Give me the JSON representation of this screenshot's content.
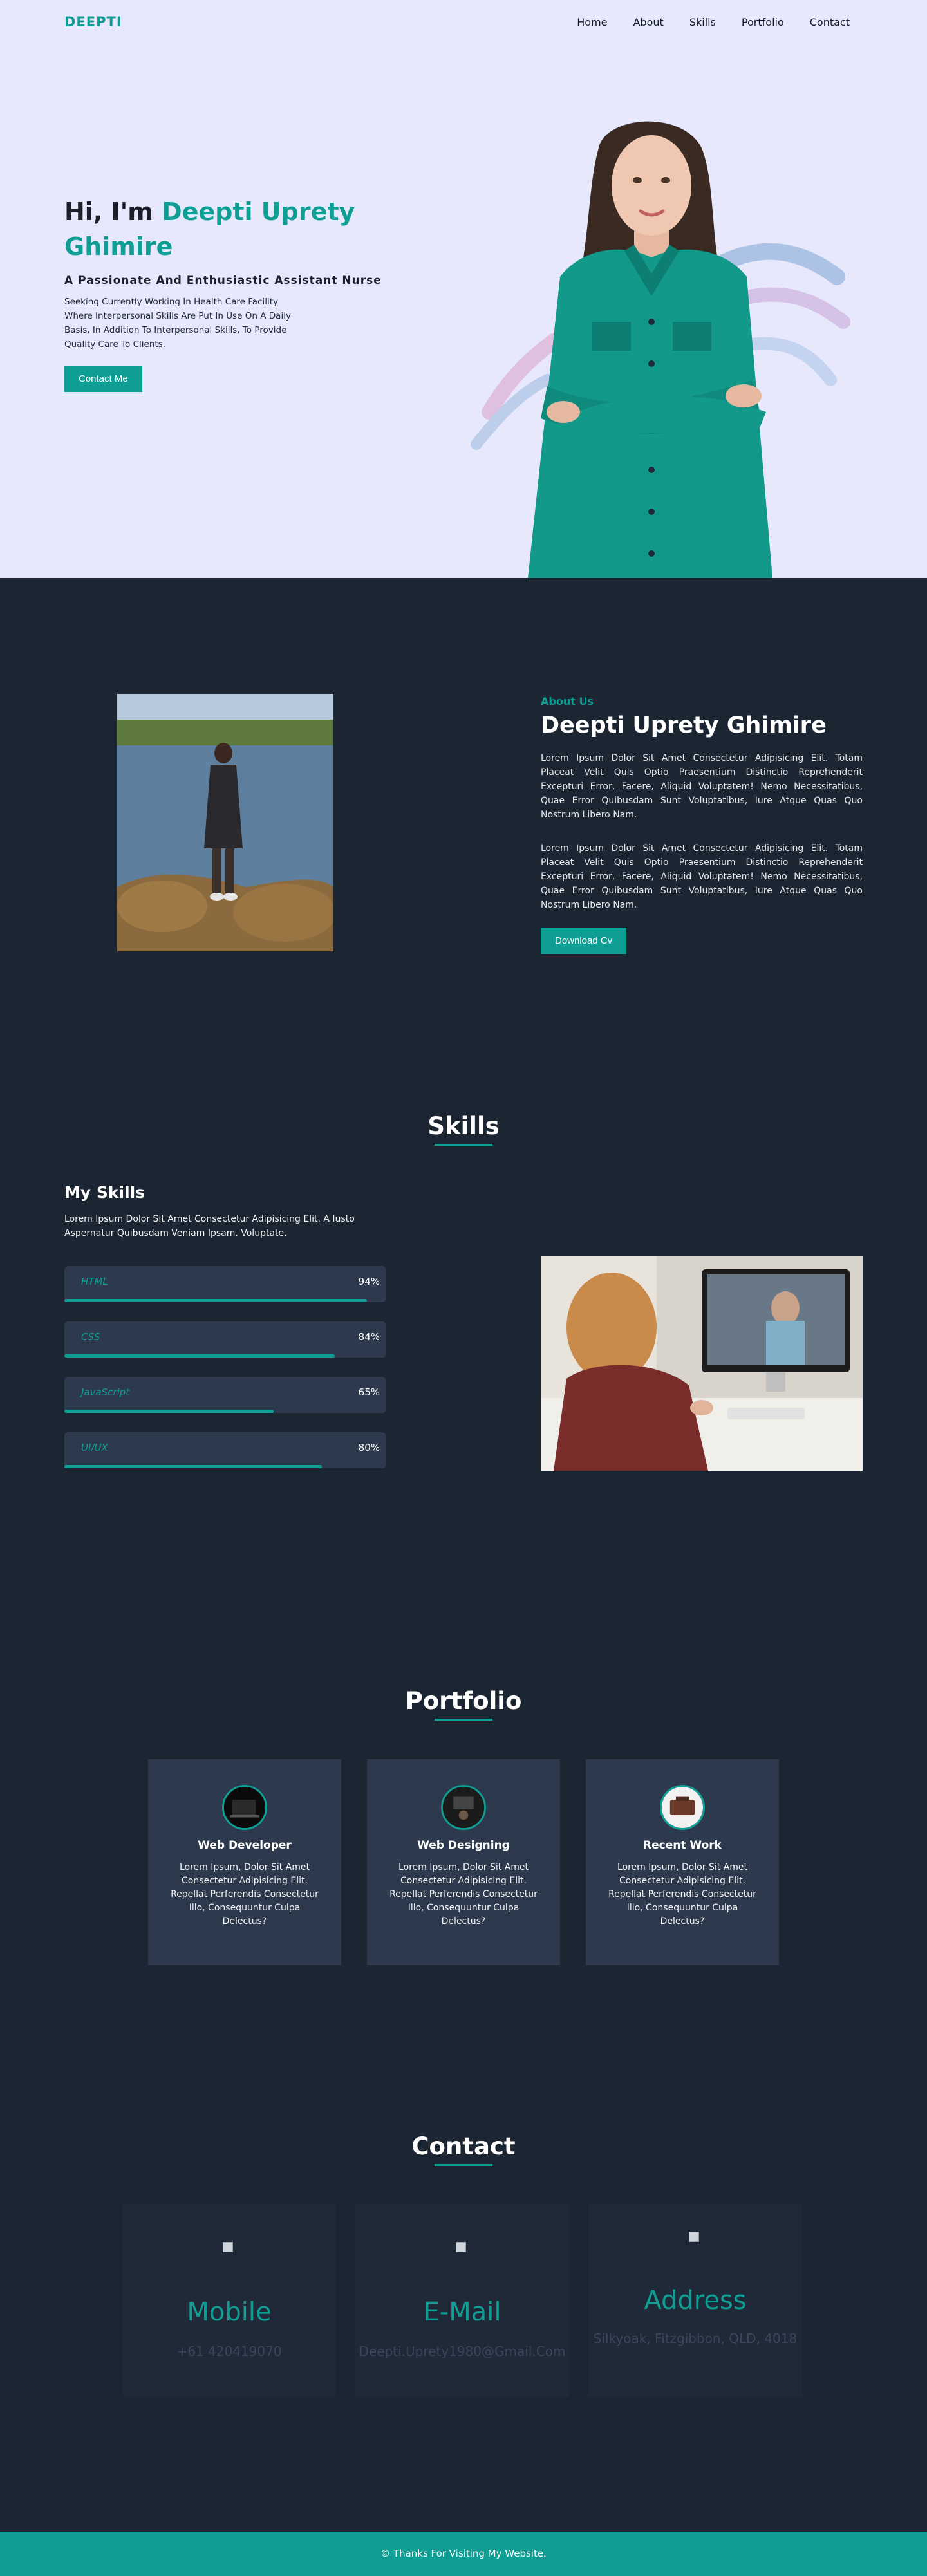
{
  "nav": {
    "logo": "DEEPTI",
    "links": [
      "Home",
      "About",
      "Skills",
      "Portfolio",
      "Contact"
    ]
  },
  "hero": {
    "greeting": "Hi, I'm ",
    "name_line1": "Deepti Uprety",
    "name_line2": "Ghimire",
    "tagline": "A Passionate And Enthusiastic Assistant Nurse",
    "description": "Seeking Currently Working In Health Care Facility Where Interpersonal Skills Are Put In Use On A Daily Basis, In Addition To Interpersonal Skills, To Provide Quality Care To Clients.",
    "button": "Contact Me"
  },
  "about": {
    "kicker": "About Us",
    "name": "Deepti Uprety Ghimire",
    "para1": "Lorem Ipsum Dolor Sit Amet Consectetur Adipisicing Elit. Totam Placeat Velit Quis Optio Praesentium Distinctio Reprehenderit Excepturi Error, Facere, Aliquid Voluptatem! Nemo Necessitatibus, Quae Error Quibusdam Sunt Voluptatibus, Iure Atque Quas Quo Nostrum Libero Nam.",
    "para2": "Lorem Ipsum Dolor Sit Amet Consectetur Adipisicing Elit. Totam Placeat Velit Quis Optio Praesentium Distinctio Reprehenderit Excepturi Error, Facere, Aliquid Voluptatem! Nemo Necessitatibus, Quae Error Quibusdam Sunt Voluptatibus, Iure Atque Quas Quo Nostrum Libero Nam.",
    "button": "Download Cv"
  },
  "skills": {
    "title": "Skills",
    "heading": "My Skills",
    "intro": "Lorem Ipsum Dolor Sit Amet Consectetur Adipisicing Elit. A Iusto Aspernatur Quibusdam Veniam Ipsam. Voluptate.",
    "items": [
      {
        "name": "HTML",
        "percent_label": "94%",
        "level": 0.94
      },
      {
        "name": "CSS",
        "percent_label": "84%",
        "level": 0.84
      },
      {
        "name": "JavaScript",
        "percent_label": "65%",
        "level": 0.65
      },
      {
        "name": "UI/UX",
        "percent_label": "80%",
        "level": 0.8
      }
    ]
  },
  "portfolio": {
    "title": "Portfolio",
    "cards": [
      {
        "title": "Web Developer",
        "text": "Lorem Ipsum, Dolor Sit Amet Consectetur Adipisicing Elit. Repellat Perferendis Consectetur Illo, Consequuntur Culpa Delectus?"
      },
      {
        "title": "Web Designing",
        "text": "Lorem Ipsum, Dolor Sit Amet Consectetur Adipisicing Elit. Repellat Perferendis Consectetur Illo, Consequuntur Culpa Delectus?"
      },
      {
        "title": "Recent Work",
        "text": "Lorem Ipsum, Dolor Sit Amet Consectetur Adipisicing Elit. Repellat Perferendis Consectetur Illo, Consequuntur Culpa Delectus?"
      }
    ]
  },
  "contact": {
    "title": "Contact",
    "cards": [
      {
        "title": "Mobile",
        "value": "+61 420419070"
      },
      {
        "title": "E-Mail",
        "value": "Deepti.Uprety1980@Gmail.Com"
      },
      {
        "title": "Address",
        "value": "Silkyoak, Fitzgibbon, QLD, 4018"
      }
    ]
  },
  "footer": {
    "text": "© Thanks For Visiting My Website."
  },
  "colors": {
    "accent": "#0f9e93",
    "hero_bg": "#e7e8fb",
    "page_bg": "#1c2532",
    "card_bg": "#2d3a4d"
  }
}
